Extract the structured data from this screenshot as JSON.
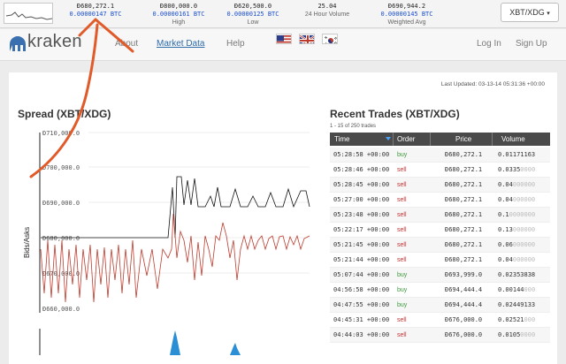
{
  "ticker": {
    "cols": [
      {
        "value": "Đ680,272.1",
        "btc": "0.00000147 BTC",
        "label": ""
      },
      {
        "value": "Đ800,000.0",
        "btc": "0.00000161 BTC",
        "label": "High"
      },
      {
        "value": "Đ620,500.0",
        "btc": "0.00000125 BTC",
        "label": "Low"
      },
      {
        "value": "25.04",
        "btc": "",
        "label": "24 Hour Volume"
      },
      {
        "value": "Đ690,944.2",
        "btc": "0.00000145 BTC",
        "label": "Weighted Avg"
      }
    ],
    "pair_label": "XBT/XDG",
    "caret": "▾"
  },
  "nav": {
    "logo_text": "kraken",
    "links": [
      "About",
      "Market Data",
      "Help"
    ],
    "login": "Log In",
    "signup": "Sign Up"
  },
  "main": {
    "last_updated": "Last Updated: 03-13-14 05:31:36 +00:00",
    "spread_title": "Spread (XBT/XDG)",
    "spread_ylabel": "Bids/Asks",
    "spread_ticks": [
      "Đ710,000.0",
      "Đ700,000.0",
      "Đ690,000.0",
      "Đ680,000.0",
      "Đ670,000.0",
      "Đ660,000.0"
    ],
    "trades_title": "Recent Trades (XBT/XDG)",
    "trades_sub": "1 - 15 of 250 trades",
    "trades_headers": [
      "Time",
      "Order",
      "Price",
      "Volume"
    ],
    "trades": [
      {
        "time": "05:28:58 +00:00",
        "order": "buy",
        "price": "Đ680,272.1",
        "vol": "0.01171163",
        "vol_faint": ""
      },
      {
        "time": "05:28:46 +00:00",
        "order": "sell",
        "price": "Đ680,272.1",
        "vol": "0.0335",
        "vol_faint": "0000"
      },
      {
        "time": "05:28:45 +00:00",
        "order": "sell",
        "price": "Đ680,272.1",
        "vol": "0.04",
        "vol_faint": "000000"
      },
      {
        "time": "05:27:00 +00:00",
        "order": "sell",
        "price": "Đ680,272.1",
        "vol": "0.04",
        "vol_faint": "000000"
      },
      {
        "time": "05:23:48 +00:00",
        "order": "sell",
        "price": "Đ680,272.1",
        "vol": "0.1",
        "vol_faint": "0000000"
      },
      {
        "time": "05:22:17 +00:00",
        "order": "sell",
        "price": "Đ680,272.1",
        "vol": "0.13",
        "vol_faint": "000000"
      },
      {
        "time": "05:21:45 +00:00",
        "order": "sell",
        "price": "Đ680,272.1",
        "vol": "0.06",
        "vol_faint": "000000"
      },
      {
        "time": "05:21:44 +00:00",
        "order": "sell",
        "price": "Đ680,272.1",
        "vol": "0.04",
        "vol_faint": "000000"
      },
      {
        "time": "05:07:44 +00:00",
        "order": "buy",
        "price": "Đ693,999.0",
        "vol": "0.02353838",
        "vol_faint": ""
      },
      {
        "time": "04:56:58 +00:00",
        "order": "buy",
        "price": "Đ694,444.4",
        "vol": "0.00144",
        "vol_faint": "000"
      },
      {
        "time": "04:47:55 +00:00",
        "order": "buy",
        "price": "Đ694,444.4",
        "vol": "0.02449133",
        "vol_faint": ""
      },
      {
        "time": "04:45:31 +00:00",
        "order": "sell",
        "price": "Đ676,000.0",
        "vol": "0.02521",
        "vol_faint": "000"
      },
      {
        "time": "04:44:03 +00:00",
        "order": "sell",
        "price": "Đ676,000.0",
        "vol": "0.0105",
        "vol_faint": "0000"
      }
    ]
  },
  "colors": {
    "bids": "#c0392b",
    "asks": "#111111",
    "volume": "#2a8fd4",
    "annotation": "#e05a2a",
    "nav_active": "#2d6aa8"
  }
}
